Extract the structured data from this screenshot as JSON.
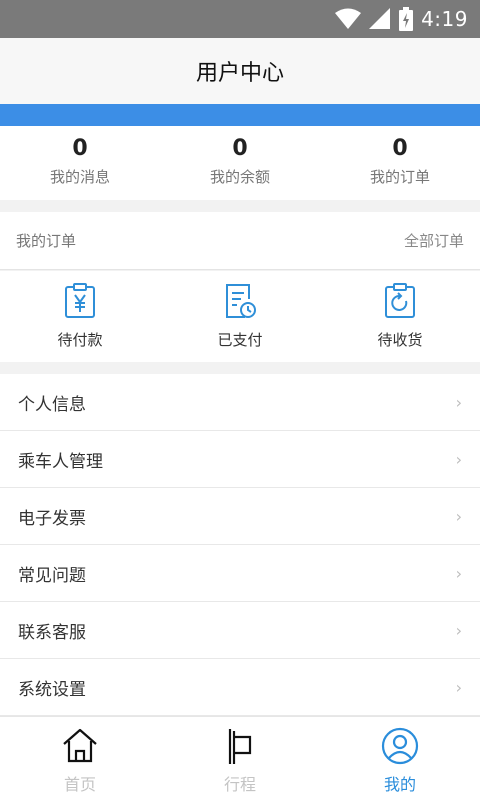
{
  "status_bar": {
    "time": "4:19"
  },
  "header": {
    "title": "用户中心"
  },
  "stats": [
    {
      "value": "0",
      "label": "我的消息"
    },
    {
      "value": "0",
      "label": "我的余额"
    },
    {
      "value": "0",
      "label": "我的订单"
    }
  ],
  "orders": {
    "title": "我的订单",
    "all_label": "全部订单",
    "items": [
      {
        "label": "待付款",
        "icon": "yen-clipboard-icon"
      },
      {
        "label": "已支付",
        "icon": "paid-clock-icon"
      },
      {
        "label": "待收货",
        "icon": "receive-refresh-icon"
      }
    ]
  },
  "menu": [
    {
      "label": "个人信息"
    },
    {
      "label": "乘车人管理"
    },
    {
      "label": "电子发票"
    },
    {
      "label": "常见问题"
    },
    {
      "label": "联系客服"
    },
    {
      "label": "系统设置"
    }
  ],
  "tabbar": [
    {
      "label": "首页",
      "icon": "home-icon"
    },
    {
      "label": "行程",
      "icon": "flag-icon"
    },
    {
      "label": "我的",
      "icon": "user-icon",
      "active": true
    }
  ],
  "colors": {
    "accent": "#3c8ee6",
    "active_tab": "#2a8ddb",
    "icon_blue": "#2f8fd8"
  }
}
